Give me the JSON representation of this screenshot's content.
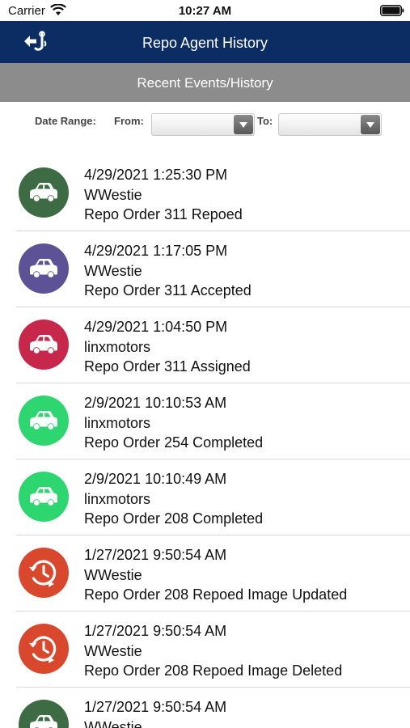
{
  "status_bar": {
    "carrier": "Carrier",
    "time": "10:27 AM"
  },
  "nav": {
    "title": "Repo Agent History",
    "back_icon": "back-arrow-tow-hook-icon"
  },
  "section": {
    "title": "Recent Events/History"
  },
  "filter": {
    "date_range_label": "Date Range:",
    "from_label": "From:",
    "to_label": "To:",
    "from_value": "",
    "to_value": ""
  },
  "colors": {
    "nav_bg": "#0b2d63",
    "section_bg": "#8c8c8c",
    "repoed": "#3d6b43",
    "accepted": "#5d5296",
    "assigned": "#c7274a",
    "completed": "#2dd66f",
    "image_event": "#d9472d"
  },
  "events": [
    {
      "datetime": "4/29/2021 1:25:30 PM",
      "user": "WWestie",
      "description": "Repo Order 311 Repoed",
      "icon": "car-icon",
      "color": "#3d6b43"
    },
    {
      "datetime": "4/29/2021 1:17:05 PM",
      "user": "WWestie",
      "description": "Repo Order 311 Accepted",
      "icon": "car-icon",
      "color": "#5d5296"
    },
    {
      "datetime": "4/29/2021 1:04:50 PM",
      "user": "linxmotors",
      "description": "Repo Order 311 Assigned",
      "icon": "car-icon",
      "color": "#c7274a"
    },
    {
      "datetime": "2/9/2021 10:10:53 AM",
      "user": "linxmotors",
      "description": "Repo Order 254 Completed",
      "icon": "car-icon",
      "color": "#2dd66f"
    },
    {
      "datetime": "2/9/2021 10:10:49 AM",
      "user": "linxmotors",
      "description": "Repo Order 208 Completed",
      "icon": "car-icon",
      "color": "#2dd66f"
    },
    {
      "datetime": "1/27/2021 9:50:54 AM",
      "user": "WWestie",
      "description": "Repo Order 208 Repoed Image Updated",
      "icon": "history-clock-icon",
      "color": "#d9472d"
    },
    {
      "datetime": "1/27/2021 9:50:54 AM",
      "user": "WWestie",
      "description": "Repo Order 208 Repoed Image Deleted",
      "icon": "history-clock-icon",
      "color": "#d9472d"
    },
    {
      "datetime": "1/27/2021 9:50:54 AM",
      "user": "WWestie",
      "description": "",
      "icon": "car-icon",
      "color": "#3d6b43"
    }
  ]
}
